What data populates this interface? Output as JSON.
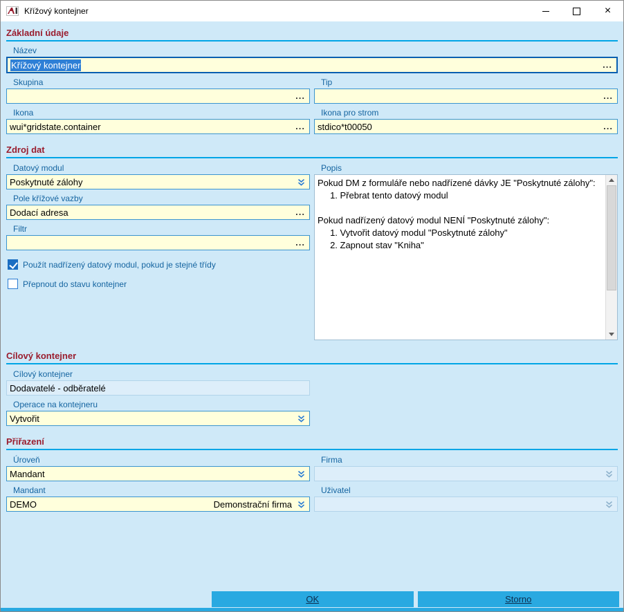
{
  "window": {
    "title": "Křížový kontejner"
  },
  "sections": {
    "basic": "Základní údaje",
    "source": "Zdroj dat",
    "target": "Cílový kontejner",
    "assignment": "Přiřazení"
  },
  "fields": {
    "nazev": {
      "label": "Název",
      "value": "Křížový kontejner"
    },
    "skupina": {
      "label": "Skupina",
      "value": ""
    },
    "tip": {
      "label": "Tip",
      "value": ""
    },
    "ikona": {
      "label": "Ikona",
      "value": "wui*gridstate.container"
    },
    "ikona_strom": {
      "label": "Ikona pro strom",
      "value": "stdico*t00050"
    },
    "datovy_modul": {
      "label": "Datový modul",
      "value": "Poskytnuté zálohy"
    },
    "pole_vazby": {
      "label": "Pole křížové vazby",
      "value": "Dodací adresa"
    },
    "filtr": {
      "label": "Filtr",
      "value": ""
    },
    "use_parent_dm": {
      "label": "Použít nadřízený datový modul, pokud je stejné třídy",
      "checked": true
    },
    "switch_state": {
      "label": "Přepnout do stavu kontejner",
      "checked": false
    },
    "popis": {
      "label": "Popis",
      "text": "Pokud DM z formuláře nebo nadřízené dávky JE \"Poskytnuté zálohy\":\n     1. Přebrat tento datový modul\n\nPokud nadřízený datový modul NENÍ \"Poskytnuté zálohy\":\n     1. Vytvořit datový modul \"Poskytnuté zálohy\"\n     2. Zapnout stav \"Kniha\""
    },
    "cilovy_kontejner": {
      "label": "Cílový kontejner",
      "value": "Dodavatelé - odběratelé"
    },
    "operace": {
      "label": "Operace na kontejneru",
      "value": "Vytvořit"
    },
    "uroven": {
      "label": "Úroveň",
      "value": "Mandant"
    },
    "firma": {
      "label": "Firma",
      "value": ""
    },
    "mandant": {
      "label": "Mandant",
      "value": "DEMO",
      "detail": "Demonstrační firma"
    },
    "uzivatel": {
      "label": "Uživatel",
      "value": ""
    }
  },
  "buttons": {
    "ok": "OK",
    "storno": "Storno"
  },
  "glyphs": {
    "ellipsis": "..."
  },
  "colors": {
    "accent": "#29a9e1",
    "section_title": "#9a1d2e",
    "label_blue": "#1464a0",
    "field_bg": "#ffffdc"
  }
}
